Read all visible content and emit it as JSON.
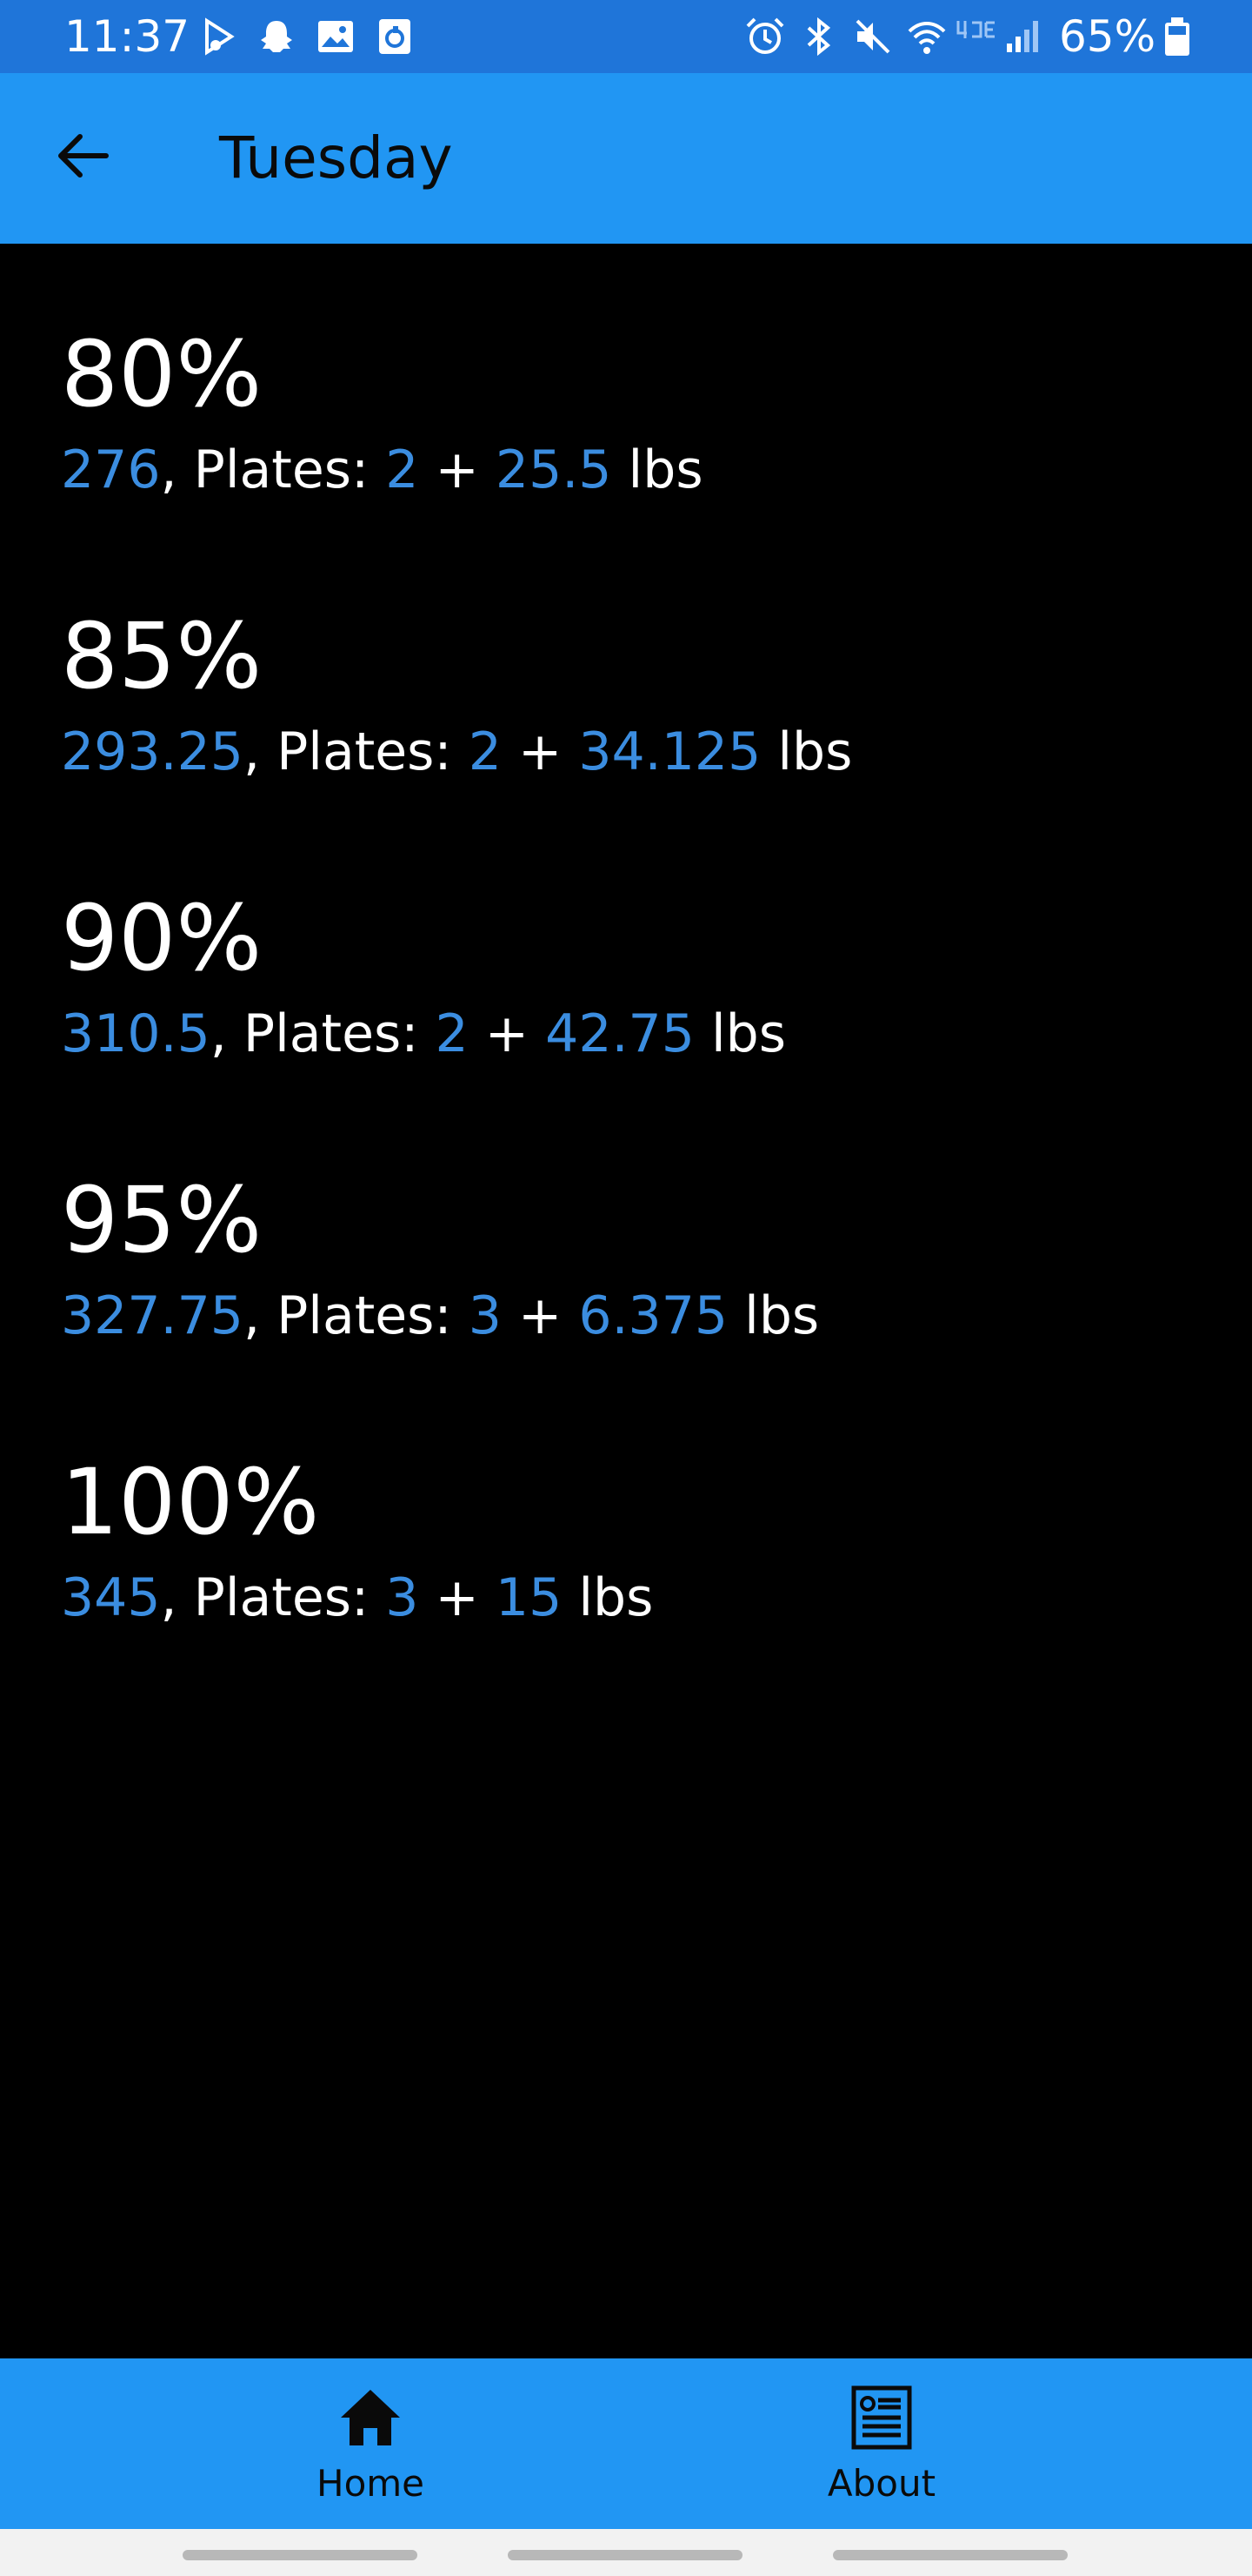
{
  "status_bar": {
    "time": "11:37",
    "battery_percent": "65%",
    "left_icons": [
      "music-note-icon",
      "snapchat-ghost-icon",
      "gallery-image-icon",
      "refresh-app-icon"
    ],
    "right_icons": [
      "alarm-icon",
      "bluetooth-icon",
      "mute-icon",
      "wifi-icon",
      "lte-icon",
      "signal-icon",
      "battery-icon"
    ]
  },
  "app_bar": {
    "title": "Tuesday",
    "back_icon": "arrow-left-icon"
  },
  "entries": [
    {
      "percent": "80%",
      "weight": "276",
      "plates_label": ", Plates: ",
      "plates": "2",
      "plus": " + ",
      "extra": "25.5",
      "unit": " lbs"
    },
    {
      "percent": "85%",
      "weight": "293.25",
      "plates_label": ", Plates: ",
      "plates": "2",
      "plus": " + ",
      "extra": "34.125",
      "unit": " lbs"
    },
    {
      "percent": "90%",
      "weight": "310.5",
      "plates_label": ", Plates: ",
      "plates": "2",
      "plus": " + ",
      "extra": "42.75",
      "unit": " lbs"
    },
    {
      "percent": "95%",
      "weight": "327.75",
      "plates_label": ", Plates: ",
      "plates": "3",
      "plus": " + ",
      "extra": "6.375",
      "unit": " lbs"
    },
    {
      "percent": "100%",
      "weight": "345",
      "plates_label": ", Plates: ",
      "plates": "3",
      "plus": " + ",
      "extra": "15",
      "unit": " lbs"
    }
  ],
  "bottom_nav": {
    "items": [
      {
        "label": "Home",
        "icon": "home-icon"
      },
      {
        "label": "About",
        "icon": "newspaper-icon"
      }
    ]
  },
  "colors": {
    "status_bar": "#1f75d9",
    "app_bar": "#2196f3",
    "background": "#000000",
    "highlight_text": "#3b8de0",
    "text": "#ffffff"
  }
}
